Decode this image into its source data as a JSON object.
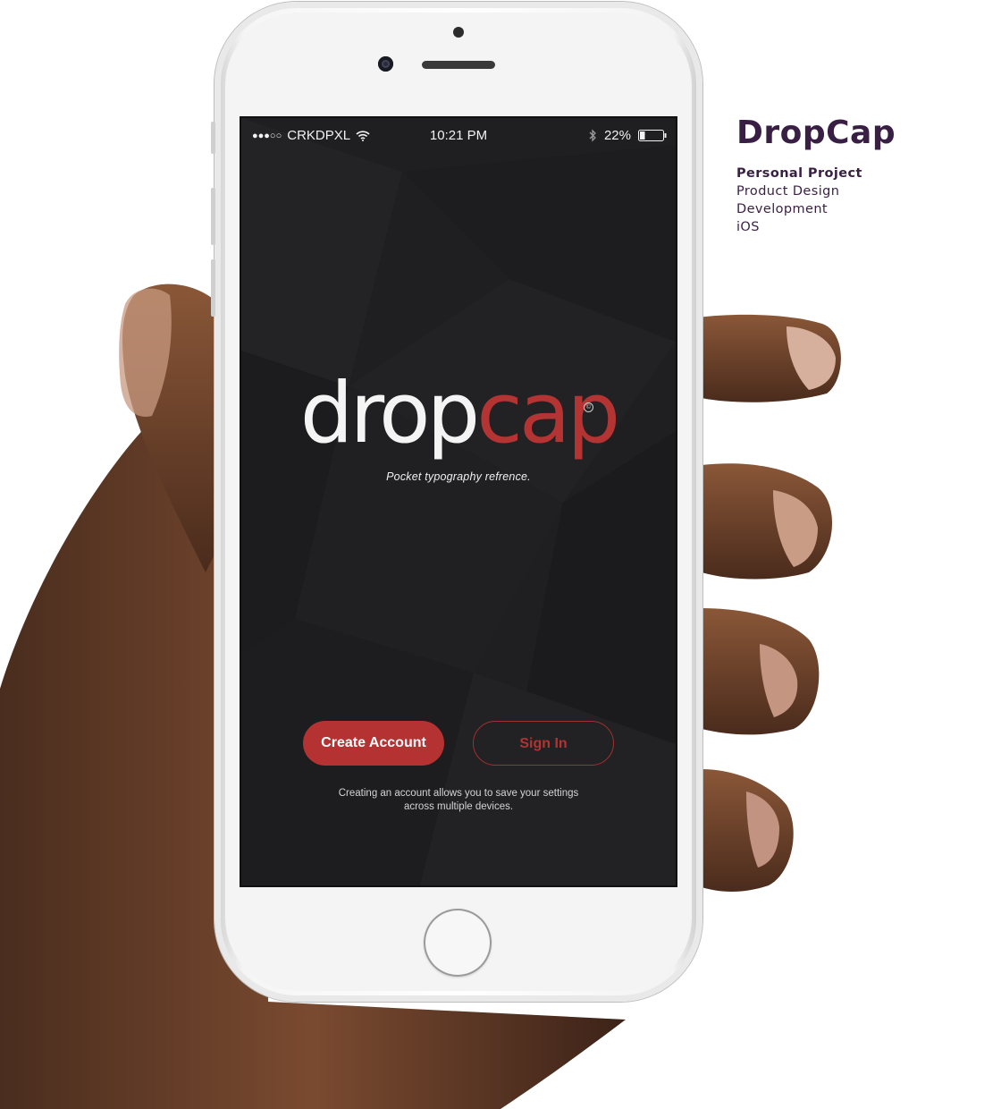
{
  "project": {
    "title": "DropCap",
    "items": [
      "Personal Project",
      "Product Design",
      "Development",
      "iOS"
    ]
  },
  "status_bar": {
    "signal_dots": "●●●○○",
    "carrier": "CRKDPXL",
    "time": "10:21 PM",
    "battery_percent": "22%",
    "battery_level": 0.22
  },
  "app": {
    "logo_part1": "drop",
    "logo_part2": "cap",
    "trademark": "©",
    "tagline": "Pocket typography refrence.",
    "create_label": "Create Account",
    "signin_label": "Sign In",
    "note": "Creating an account allows you to save your settings across multiple devices."
  },
  "colors": {
    "accent_red": "#b43232",
    "screen_bg": "#1f1e20",
    "title_purple": "#3a1f45"
  }
}
